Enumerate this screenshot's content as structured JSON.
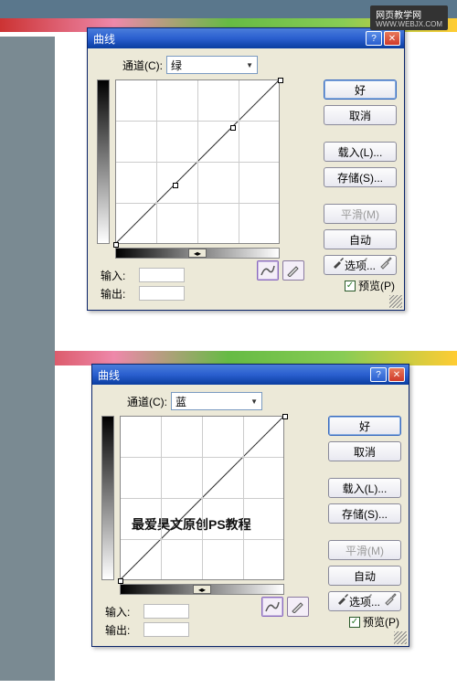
{
  "watermark": {
    "main": "网页教学网",
    "sub": "WWW.WEBJX.COM"
  },
  "dialogs": [
    {
      "title": "曲线",
      "channel_label": "通道(C):",
      "channel_value": "绿",
      "input_label": "输入:",
      "output_label": "输出:",
      "buttons": {
        "ok": "好",
        "cancel": "取消",
        "load": "载入(L)...",
        "save": "存储(S)...",
        "smooth": "平滑(M)",
        "auto": "自动",
        "options": "选项..."
      },
      "preview_label": "预览(P)",
      "preview_checked": true
    },
    {
      "title": "曲线",
      "channel_label": "通道(C):",
      "channel_value": "蓝",
      "input_label": "输入:",
      "output_label": "输出:",
      "buttons": {
        "ok": "好",
        "cancel": "取消",
        "load": "载入(L)...",
        "save": "存储(S)...",
        "smooth": "平滑(M)",
        "auto": "自动",
        "options": "选项..."
      },
      "preview_label": "预览(P)",
      "preview_checked": true,
      "overlay": "最爱昊文原创PS教程"
    }
  ]
}
